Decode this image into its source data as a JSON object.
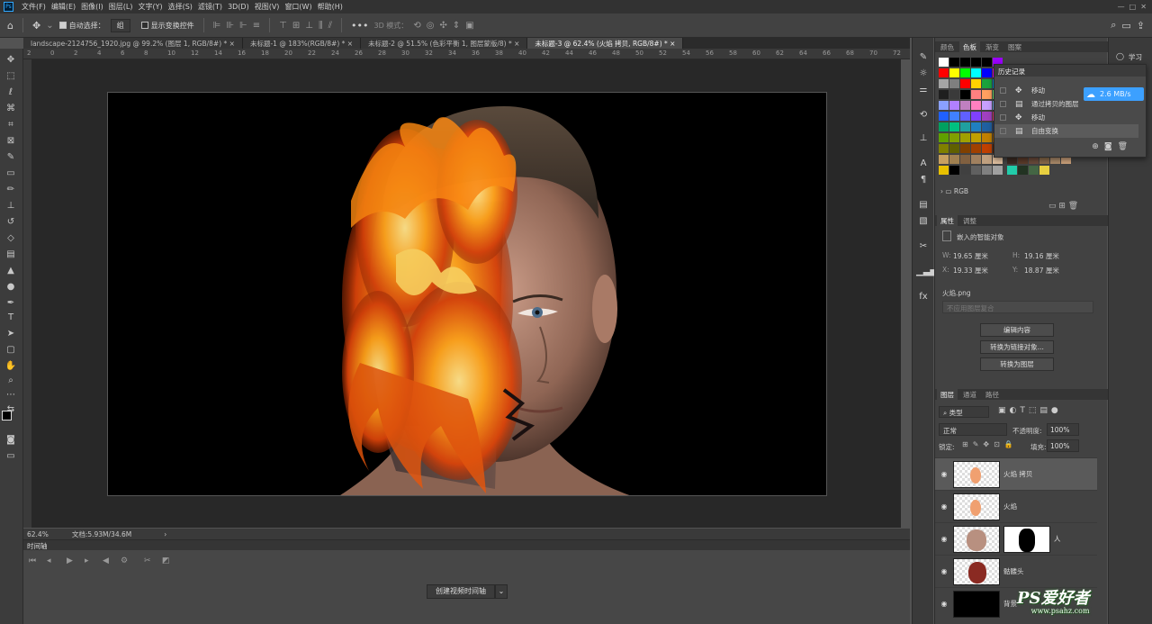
{
  "menubar": {
    "items": [
      "文件(F)",
      "编辑(E)",
      "图像(I)",
      "图层(L)",
      "文字(Y)",
      "选择(S)",
      "滤镜(T)",
      "3D(D)",
      "视图(V)",
      "窗口(W)",
      "帮助(H)"
    ]
  },
  "options": {
    "auto_select_label": "自动选择：",
    "auto_select_value": "组",
    "show_transform_label": "显示变换控件",
    "mode_3d_label": "3D 模式："
  },
  "tabs": [
    "landscape-2124756_1920.jpg @ 99.2% (图层 1, RGB/8#) *",
    "未标题-1 @ 183%(RGB/8#) *",
    "未标题-2 @ 51.5% (色彩平衡 1, 图层蒙版/8) *",
    "未标题-3 @ 62.4% (火焰 拷贝, RGB/8#) *"
  ],
  "ruler_ticks": [
    "2",
    "0",
    "2",
    "4",
    "6",
    "8",
    "10",
    "12",
    "14",
    "16",
    "18",
    "20",
    "22",
    "24",
    "26",
    "28",
    "30",
    "32",
    "34",
    "36",
    "38",
    "40",
    "42",
    "44",
    "46",
    "48",
    "50",
    "52",
    "54",
    "56",
    "58",
    "60",
    "62",
    "64",
    "66",
    "68",
    "70",
    "72"
  ],
  "status": {
    "zoom": "62.4%",
    "doc": "文档:5.93M/34.6M"
  },
  "timeline": {
    "title": "时间轴",
    "create_button": "创建视频时间轴"
  },
  "swatches_panel": {
    "tabs": [
      "颜色",
      "色板",
      "渐变",
      "图案"
    ],
    "active_tab": "色板",
    "group": "RGB"
  },
  "history": {
    "title": "历史记录",
    "items": [
      "移动",
      "通过拷贝的图层",
      "移动",
      "自由变换"
    ]
  },
  "speed_badge": "2.6 MB/s",
  "properties": {
    "tabs": [
      "属性",
      "调整"
    ],
    "type_label": "嵌入的智能对象",
    "w_label": "W:",
    "w_value": "19.65 厘米",
    "h_label": "H:",
    "h_value": "19.16 厘米",
    "x_label": "X:",
    "x_value": "19.33 厘米",
    "y_label": "Y:",
    "y_value": "18.87 厘米",
    "file": "火焰.png",
    "comp_select": "不应用图层复合",
    "btn_edit": "编辑内容",
    "btn_link": "转换为链接对象...",
    "btn_layer": "转换为图层"
  },
  "layers": {
    "tabs": [
      "图层",
      "通道",
      "路径"
    ],
    "filter": "类型",
    "blend": "正常",
    "opacity_label": "不透明度:",
    "opacity": "100%",
    "lock_label": "锁定:",
    "fill_label": "填充:",
    "fill": "100%",
    "items": [
      {
        "name": "火焰 拷贝"
      },
      {
        "name": "火焰"
      },
      {
        "name": "人"
      },
      {
        "name": "骷髅头"
      },
      {
        "name": "背景"
      }
    ]
  },
  "right_top_label": "学习",
  "watermark": {
    "logo": "PS爱好者",
    "url": "www.psahz.com"
  }
}
